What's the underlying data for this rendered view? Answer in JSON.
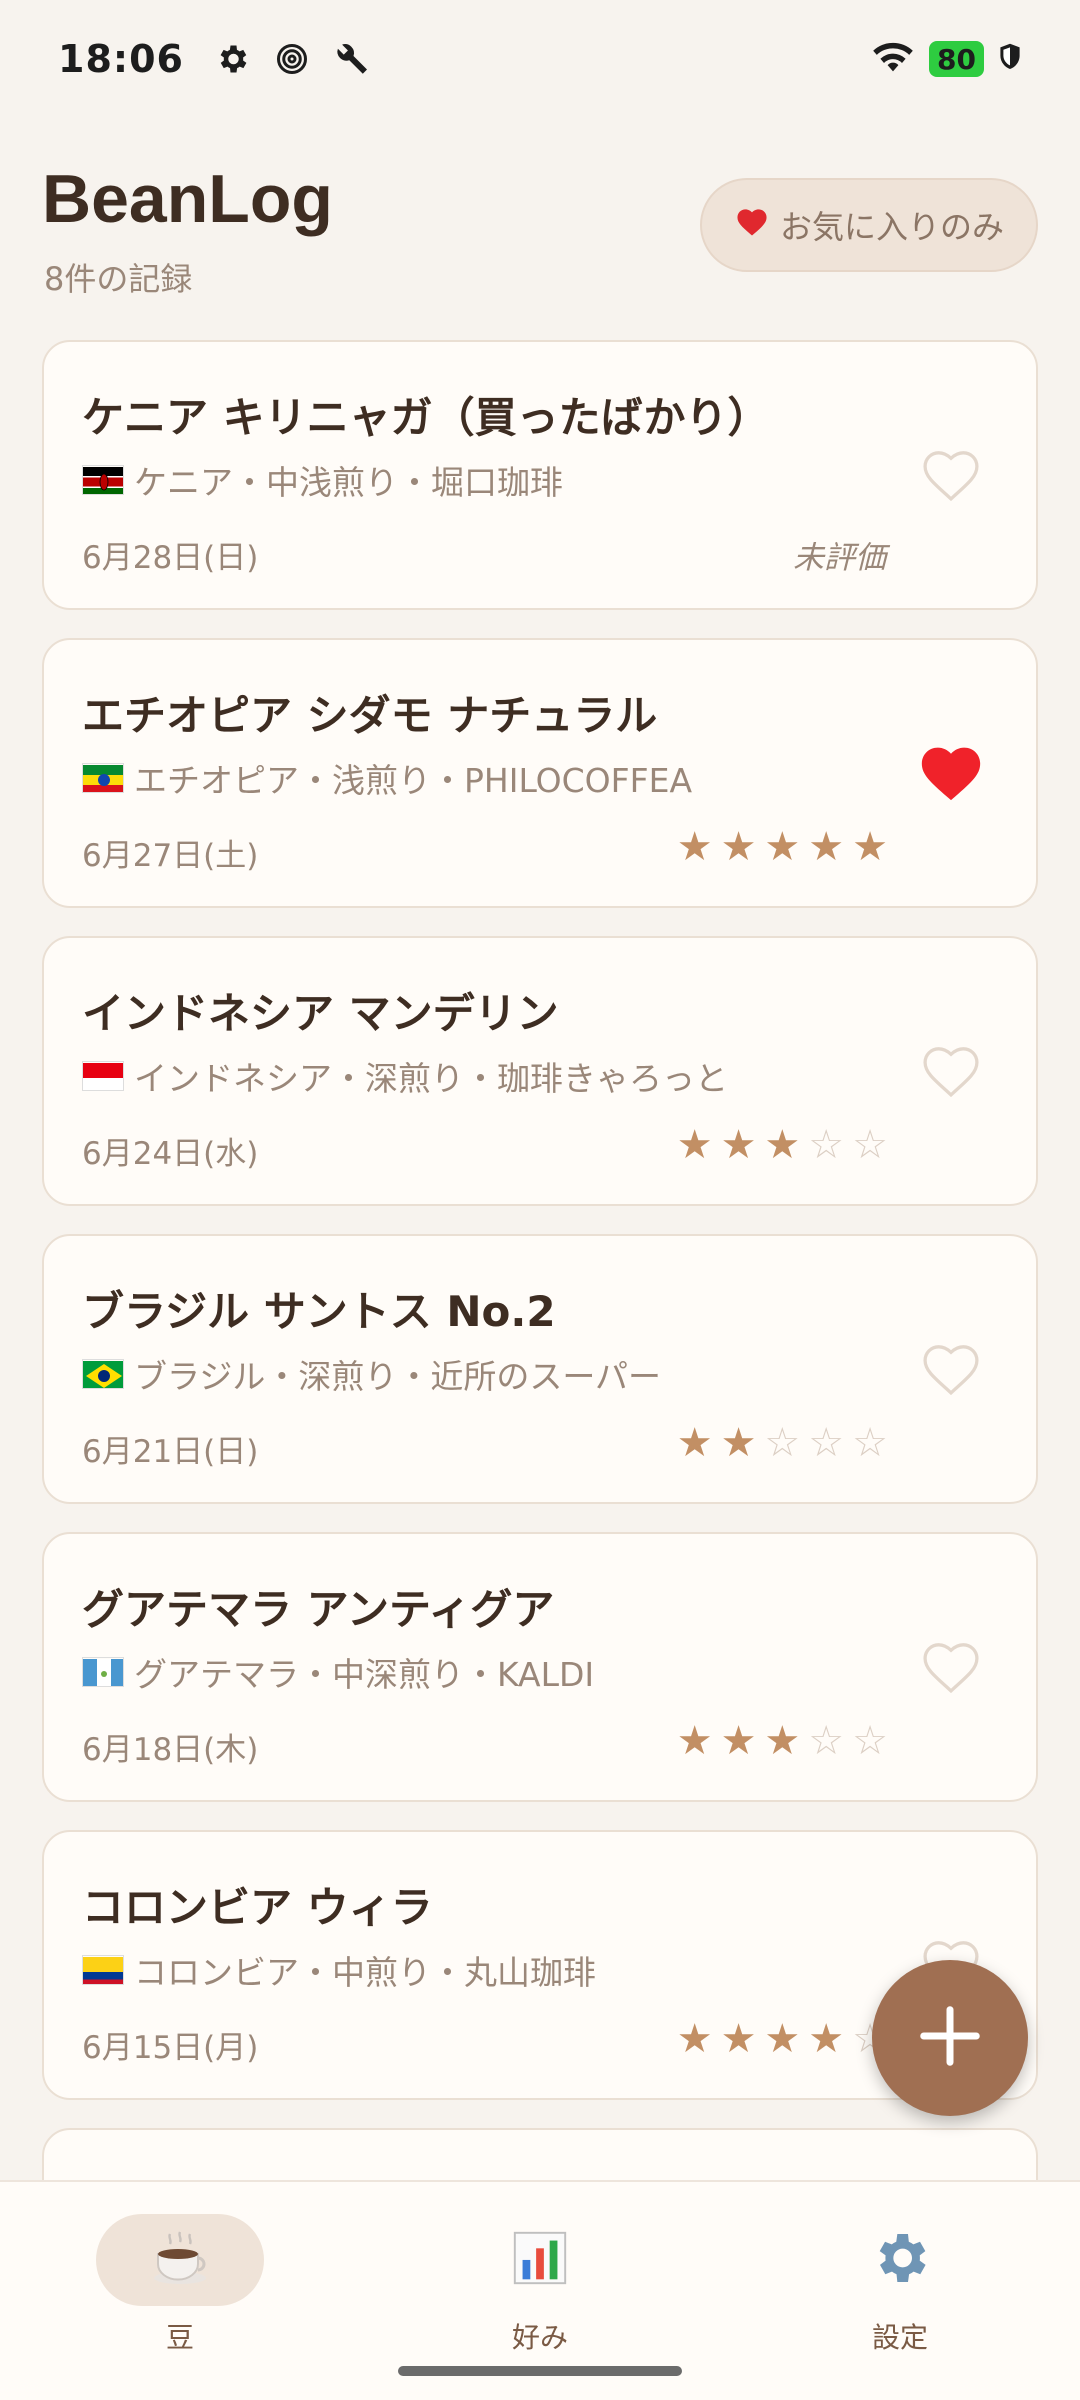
{
  "status": {
    "time": "18:06",
    "battery": "80",
    "icons": [
      "gear-icon",
      "spiral-icon",
      "wrench-icon",
      "wifi-icon",
      "shield-icon"
    ]
  },
  "header": {
    "title": "BeanLog",
    "count": "8件の記録",
    "favorites_filter": "お気に入りのみ"
  },
  "cards": [
    {
      "title": "ケニア キリニャガ（買ったばかり）",
      "meta": "ケニア・中浅煎り・堀口珈琲",
      "flag": "kenya",
      "date": "6月28日(日)",
      "rating": null,
      "unrated_label": "未評価",
      "favorite": false
    },
    {
      "title": "エチオピア シダモ ナチュラル",
      "meta": "エチオピア・浅煎り・PHILOCOFFEA",
      "flag": "ethiopia",
      "date": "6月27日(土)",
      "rating": 5,
      "favorite": true
    },
    {
      "title": "インドネシア マンデリン",
      "meta": "インドネシア・深煎り・珈琲きゃろっと",
      "flag": "indonesia",
      "date": "6月24日(水)",
      "rating": 3,
      "favorite": false
    },
    {
      "title": "ブラジル サントス No.2",
      "meta": "ブラジル・深煎り・近所のスーパー",
      "flag": "brazil",
      "date": "6月21日(日)",
      "rating": 2,
      "favorite": false
    },
    {
      "title": "グアテマラ アンティグア",
      "meta": "グアテマラ・中深煎り・KALDI",
      "flag": "guatemala",
      "date": "6月18日(木)",
      "rating": 3,
      "favorite": false
    },
    {
      "title": "コロンビア ウィラ",
      "meta": "コロンビア・中煎り・丸山珈琲",
      "flag": "colombia",
      "date": "6月15日(月)",
      "rating": 4,
      "favorite": false
    }
  ],
  "nav": {
    "items": [
      {
        "label": "豆",
        "icon": "coffee-cup-icon",
        "active": true
      },
      {
        "label": "好み",
        "icon": "bar-chart-icon",
        "active": false
      },
      {
        "label": "設定",
        "icon": "gear-icon",
        "active": false
      }
    ]
  },
  "colors": {
    "background": "#F7F3EE",
    "accent": "#A06F52",
    "star": "#C28F64",
    "heart_active": "#E0282E"
  }
}
